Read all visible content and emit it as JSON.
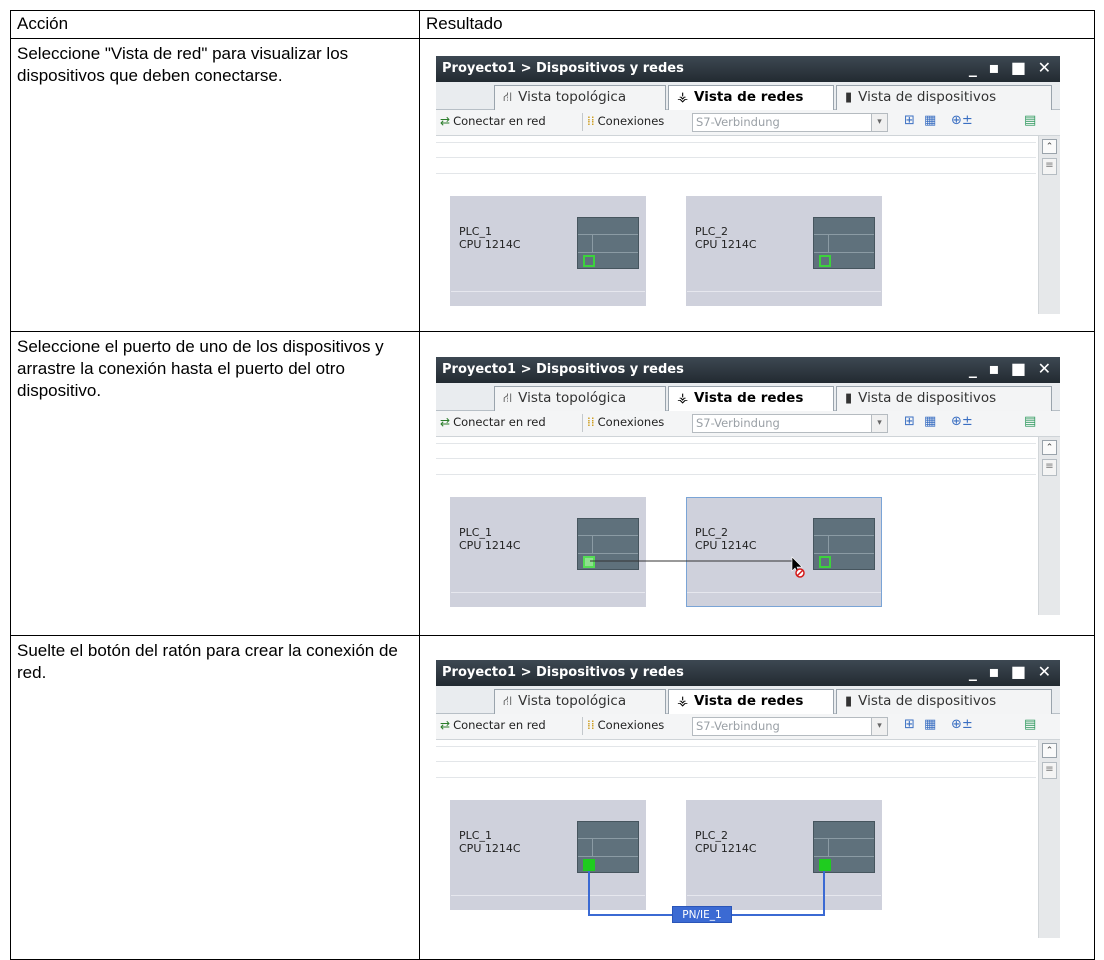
{
  "table": {
    "header_action": "Acción",
    "header_result": "Resultado"
  },
  "rows": [
    {
      "action": "Seleccione \"Vista de red\" para visualizar los dispositivos que deben conectarse.",
      "connection_state": "none"
    },
    {
      "action": "Seleccione el puerto de uno de los dispositivos y arrastre la conexión hasta el puerto del otro dispositivo.",
      "connection_state": "dragging"
    },
    {
      "action": "Suelte el botón del ratón para crear la conexión de red.",
      "connection_state": "connected",
      "network_label": "PN/IE_1"
    }
  ],
  "window": {
    "title": "Proyecto1 > Dispositivos y redes",
    "controls": "_ ▪ ■ ✕",
    "tabs": {
      "topology": "Vista topológica",
      "network": "Vista de redes",
      "devices": "Vista de dispositivos"
    },
    "toolbar": {
      "connect_label": "Conectar en red",
      "connections_label": "Conexiones",
      "connection_type": "S7-Verbindung"
    },
    "devices": [
      {
        "name": "PLC_1",
        "cpu": "CPU 1214C"
      },
      {
        "name": "PLC_2",
        "cpu": "CPU 1214C"
      }
    ]
  },
  "colors": {
    "titlebar": "#2c3640",
    "device_bg": "#cfd1dc",
    "module": "#5f717c",
    "port_green": "#1fcc1f",
    "network_line": "#3b6ad3"
  }
}
